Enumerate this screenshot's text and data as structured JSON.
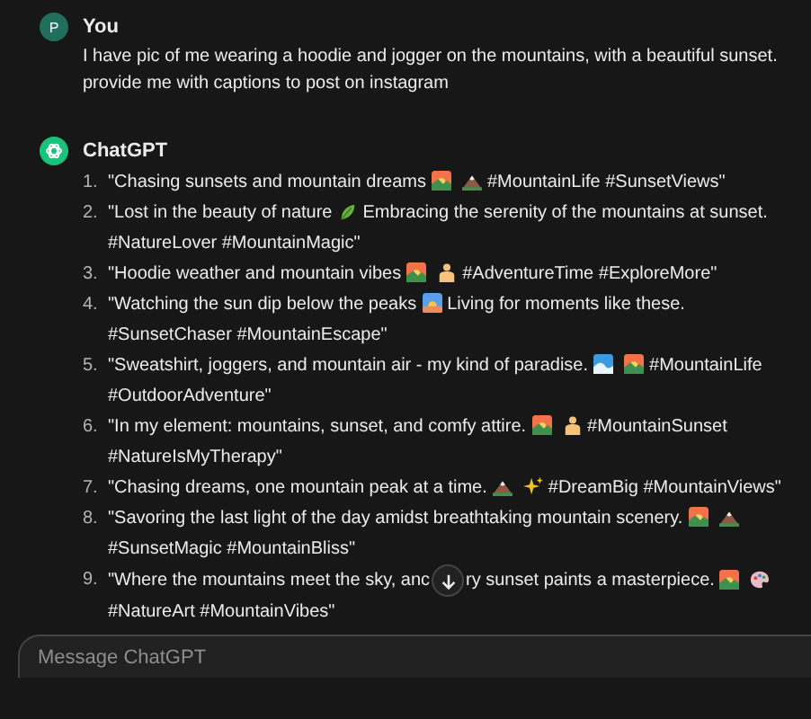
{
  "user": {
    "avatar": "P",
    "name": "You",
    "message": "I have pic of me wearing a hoodie and jogger on the mountains, with a beautiful sunset. provide me with captions to post on instagram"
  },
  "assistant": {
    "name": "ChatGPT",
    "captions": [
      {
        "number": "1.",
        "parts": [
          {
            "kind": "text",
            "text": "\"Chasing sunsets and mountain dreams"
          },
          {
            "kind": "sunset"
          },
          {
            "kind": "mountain"
          },
          {
            "kind": "text",
            "text": "#MountainLife #SunsetViews\""
          }
        ]
      },
      {
        "number": "2.",
        "parts": [
          {
            "kind": "text",
            "text": "\"Lost in the beauty of nature"
          },
          {
            "kind": "leaf"
          },
          {
            "kind": "text",
            "text": "Embracing the serenity of the mountains at sunset. #NatureLover #MountainMagic\""
          }
        ]
      },
      {
        "number": "3.",
        "parts": [
          {
            "kind": "text",
            "text": "\"Hoodie weather and mountain vibes"
          },
          {
            "kind": "sunset"
          },
          {
            "kind": "person"
          },
          {
            "kind": "text",
            "text": "#AdventureTime #ExploreMore\""
          }
        ]
      },
      {
        "number": "4.",
        "parts": [
          {
            "kind": "text",
            "text": "\"Watching the sun dip below the peaks"
          },
          {
            "kind": "sunrise"
          },
          {
            "kind": "text",
            "text": "Living for moments like these. #SunsetChaser #MountainEscape\""
          }
        ]
      },
      {
        "number": "5.",
        "parts": [
          {
            "kind": "text",
            "text": "\"Sweatshirt, joggers, and mountain air - my kind of paradise."
          },
          {
            "kind": "wave"
          },
          {
            "kind": "sunset"
          },
          {
            "kind": "text",
            "text": "#MountainLife #OutdoorAdventure\""
          }
        ]
      },
      {
        "number": "6.",
        "parts": [
          {
            "kind": "text",
            "text": "\"In my element: mountains, sunset, and comfy attire."
          },
          {
            "kind": "sunset"
          },
          {
            "kind": "person"
          },
          {
            "kind": "text",
            "text": "#MountainSunset #NatureIsMyTherapy\""
          }
        ]
      },
      {
        "number": "7.",
        "parts": [
          {
            "kind": "text",
            "text": "\"Chasing dreams, one mountain peak at a time."
          },
          {
            "kind": "mountain"
          },
          {
            "kind": "sparkles"
          },
          {
            "kind": "text",
            "text": "#DreamBig #MountainViews\""
          }
        ]
      },
      {
        "number": "8.",
        "parts": [
          {
            "kind": "text",
            "text": "\"Savoring the last light of the day amidst breathtaking mountain scenery."
          },
          {
            "kind": "sunset"
          },
          {
            "kind": "mountain"
          },
          {
            "kind": "text",
            "text": "#SunsetMagic #MountainBliss\""
          }
        ]
      },
      {
        "number": "9.",
        "parts": [
          {
            "kind": "text",
            "text": "\"Where the mountains meet the sky, anc"
          },
          {
            "kind": "scroll"
          },
          {
            "kind": "text",
            "text": "ry sunset paints a masterpiece."
          },
          {
            "kind": "sunset"
          },
          {
            "kind": "palette"
          },
          {
            "kind": "text",
            "text": "#NatureArt #MountainVibes\""
          }
        ]
      }
    ]
  },
  "composer": {
    "placeholder": "Message ChatGPT"
  }
}
